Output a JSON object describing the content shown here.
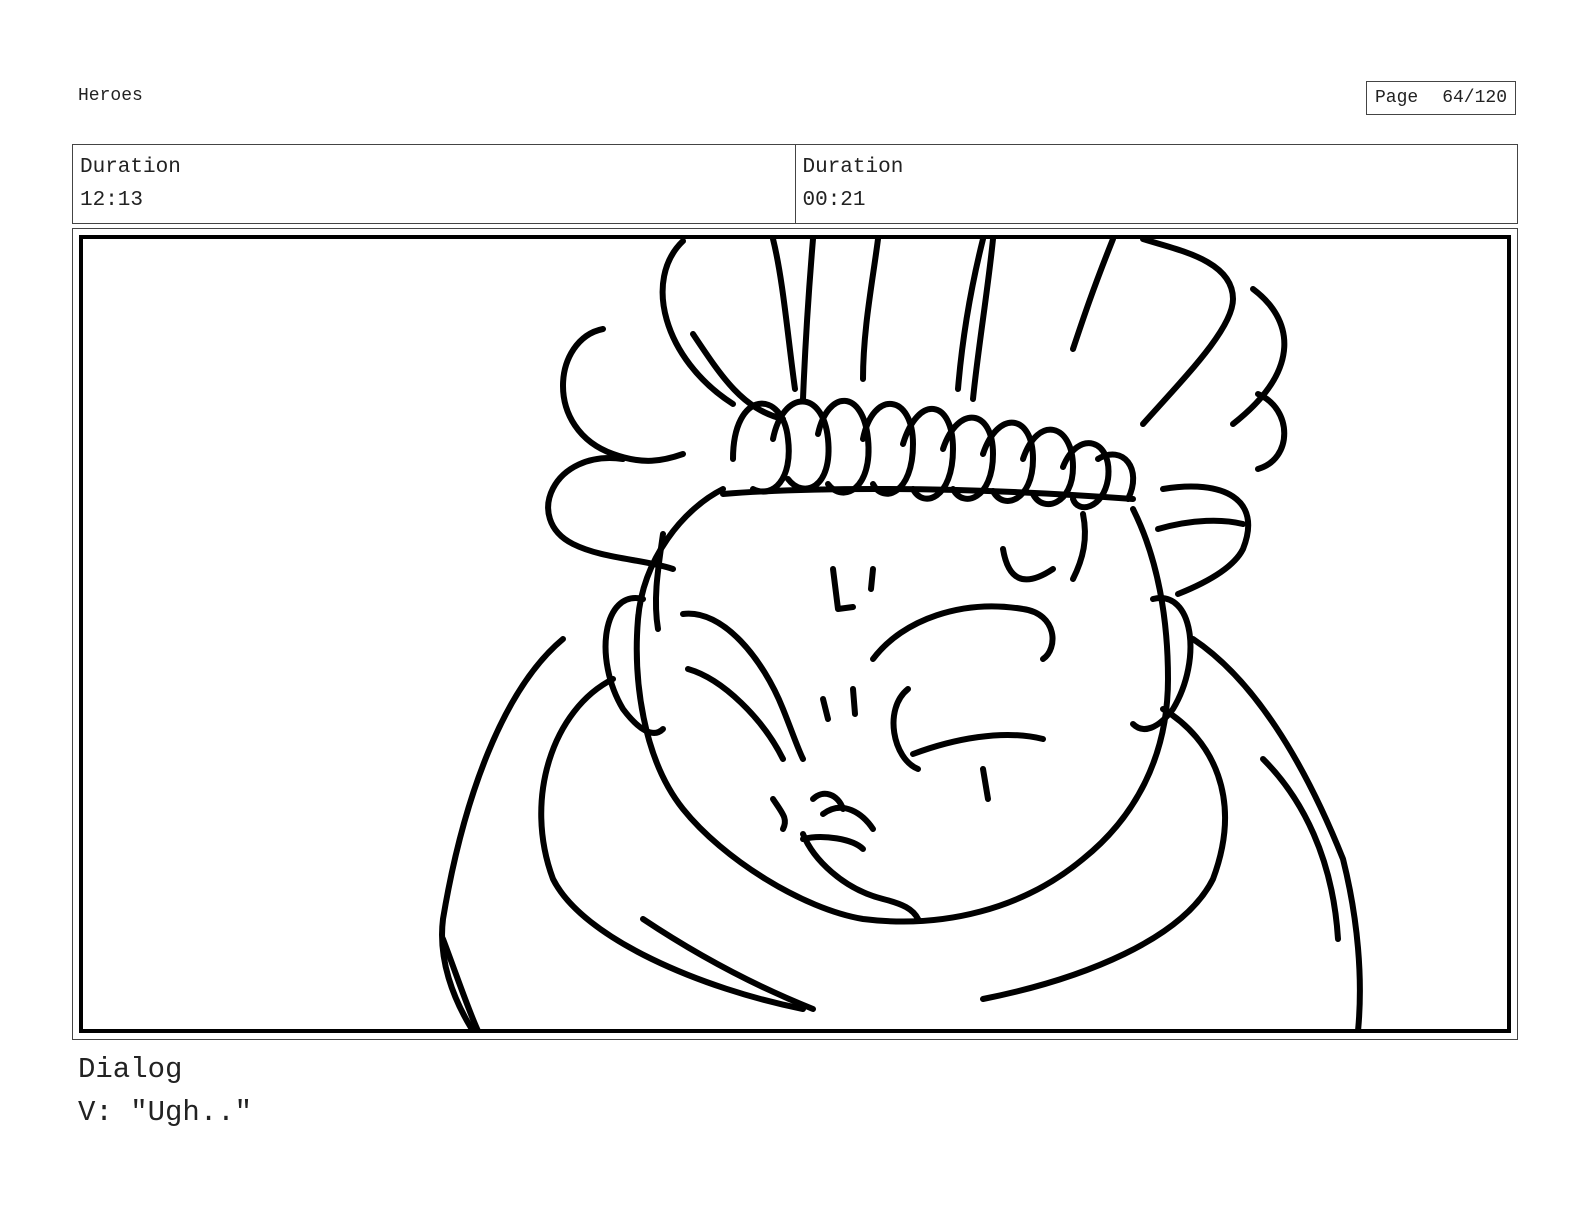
{
  "header": {
    "project_title": "Heroes",
    "page_label": "Page",
    "page_number": "64/120"
  },
  "durations": [
    {
      "label": "Duration",
      "value": "12:13"
    },
    {
      "label": "Duration",
      "value": "00:21"
    }
  ],
  "panel": {
    "image_subject": "sketch-character-head"
  },
  "dialog": {
    "heading": "Dialog",
    "line": "V: \"Ugh..\""
  }
}
